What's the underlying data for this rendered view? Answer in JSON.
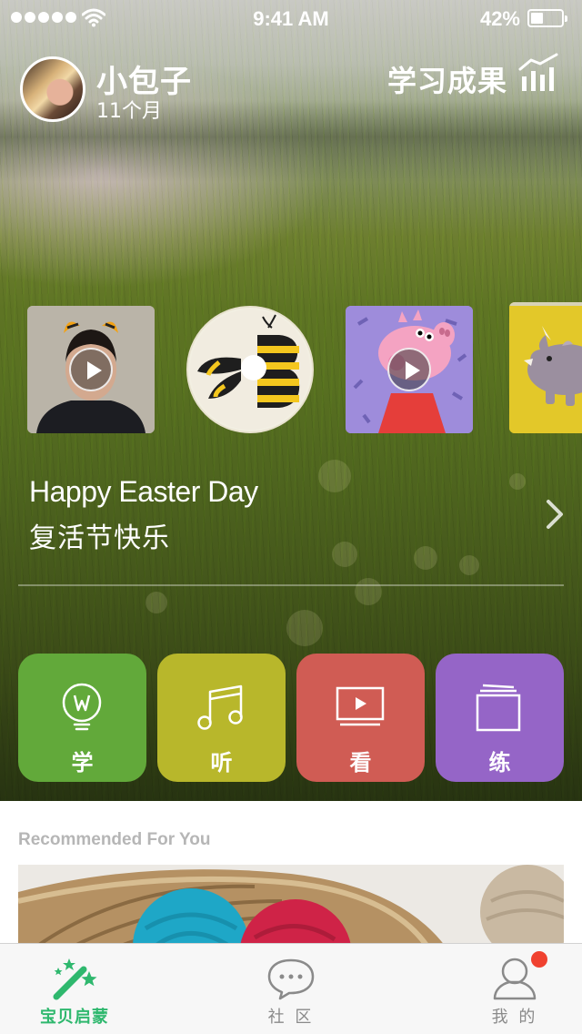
{
  "status_bar": {
    "time": "9:41 AM",
    "battery_percent": "42%",
    "battery_level": 0.42,
    "signal_icon": "signal-dots-icon",
    "wifi_icon": "wifi-icon"
  },
  "profile": {
    "name": "小包子",
    "age": "11个月",
    "results_label": "学习成果",
    "results_icon": "bar-chart-trend-icon"
  },
  "carousel": {
    "items": [
      {
        "name": "tiger-ears-video",
        "has_play": true
      },
      {
        "name": "bee-letter-b-craft",
        "has_play": false
      },
      {
        "name": "peppa-pig-video",
        "has_play": true
      },
      {
        "name": "rhino-cartoon",
        "has_play": false
      }
    ],
    "title_en": "Happy Easter Day",
    "title_zh": "复活节快乐",
    "next_icon": "chevron-right-icon"
  },
  "categories": [
    {
      "label": "学",
      "icon": "lightbulb-icon",
      "color": "#62a93a"
    },
    {
      "label": "听",
      "icon": "music-note-icon",
      "color": "#b8b72b"
    },
    {
      "label": "看",
      "icon": "play-screen-icon",
      "color": "#d05c54"
    },
    {
      "label": "练",
      "icon": "book-stack-icon",
      "color": "#9565c7"
    }
  ],
  "recommended": {
    "heading": "Recommended For You"
  },
  "tab_bar": {
    "items": [
      {
        "label": "宝贝启蒙",
        "icon": "magic-wand-stars-icon",
        "active": true
      },
      {
        "label": "社 区",
        "icon": "chat-bubble-icon",
        "active": false
      },
      {
        "label": "我 的",
        "icon": "person-icon",
        "active": false,
        "badge": true
      }
    ],
    "active_color": "#2fb86e"
  }
}
